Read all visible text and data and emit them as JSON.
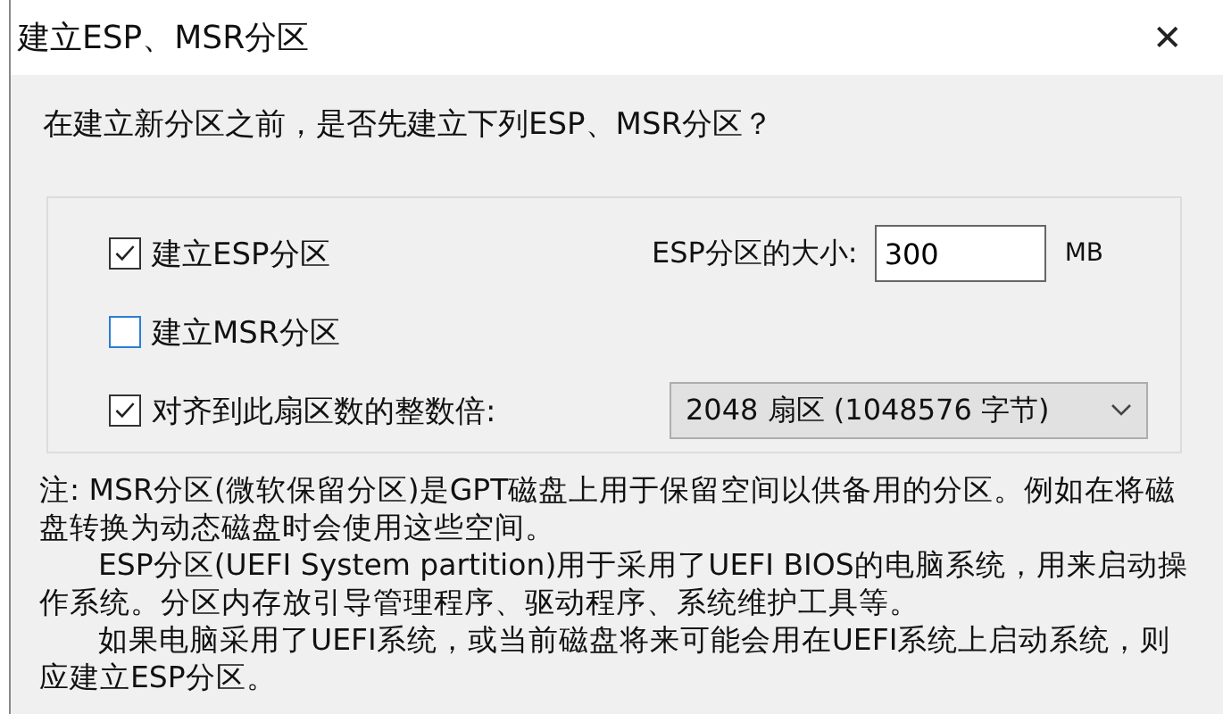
{
  "window": {
    "title": "建立ESP、MSR分区",
    "close": "✕"
  },
  "prompt": "在建立新分区之前，是否先建立下列ESP、MSR分区？",
  "options": [
    {
      "kind": "check",
      "label": "建立ESP分区",
      "checked": true,
      "field_label": "ESP分区的大小:",
      "value": "300",
      "unit": "MB"
    },
    {
      "kind": "check",
      "label": "建立MSR分区",
      "checked": false
    },
    {
      "kind": "select",
      "label": "对齐到此扇区数的整数倍:",
      "checked": true,
      "value": "2048 扇区 (1048576 字节)"
    }
  ],
  "notes": [
    {
      "indent": false,
      "text": "注: MSR分区(微软保留分区)是GPT磁盘上用于保留空间以供备用的分区。例如在将磁盘转换为动态磁盘时会使用这些空间。"
    },
    {
      "indent": true,
      "text": "ESP分区(UEFI System partition)用于采用了UEFI BIOS的电脑系统，用来启动操作系统。分区内存放引导管理程序、驱动程序、系统维护工具等。"
    },
    {
      "indent": true,
      "text": "如果电脑采用了UEFI系统，或当前磁盘将来可能会用在UEFI系统上启动系统，则应建立ESP分区。"
    }
  ]
}
